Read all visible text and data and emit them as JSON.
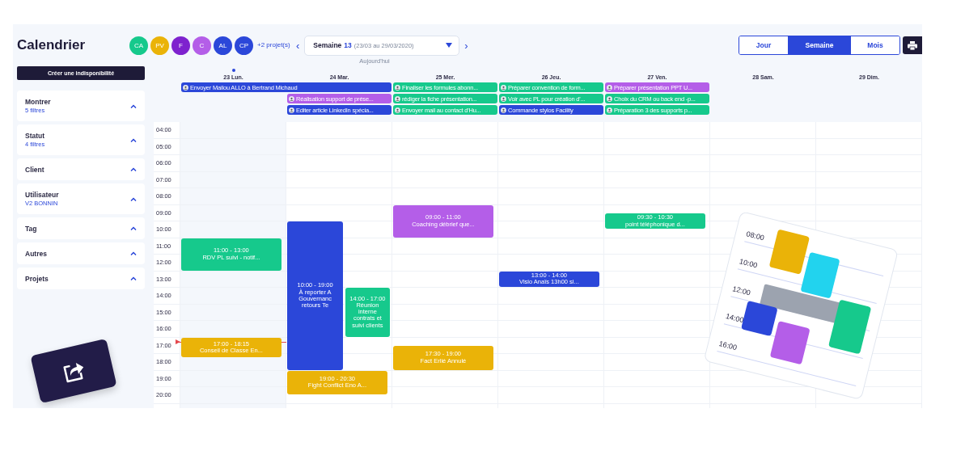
{
  "title": "Calendrier",
  "avatars": [
    {
      "initials": "CA",
      "color": "#16c98c"
    },
    {
      "initials": "PV",
      "color": "#eab308"
    },
    {
      "initials": "F",
      "color": "#7e22ce"
    },
    {
      "initials": "C",
      "color": "#b45ee8"
    },
    {
      "initials": "AL",
      "color": "#2b47d9"
    },
    {
      "initials": "CP",
      "color": "#2b47d9"
    }
  ],
  "more_projects": "+2 projet(s)",
  "prev": "‹",
  "next": "›",
  "week_selector": {
    "label": "Semaine",
    "number": "13",
    "range": "(23/03 au 29/03/2020)"
  },
  "today_link": "Aujourd'hui",
  "views": [
    {
      "label": "Jour",
      "selected": false
    },
    {
      "label": "Semaine",
      "selected": true
    },
    {
      "label": "Mois",
      "selected": false
    }
  ],
  "create_button": "Créer une indisponibilité",
  "filters": [
    {
      "title": "Montrer",
      "subtitle": "5 filtres"
    },
    {
      "title": "Statut",
      "subtitle": "4 filtres"
    },
    {
      "title": "Client"
    },
    {
      "title": "Utilisateur",
      "subtitle": "V2 BONNIN"
    },
    {
      "title": "Tag"
    },
    {
      "title": "Autres"
    },
    {
      "title": "Projets"
    }
  ],
  "hours": [
    "04:00",
    "05:00",
    "06:00",
    "07:00",
    "08:00",
    "09:00",
    "10:00",
    "11:00",
    "12:00",
    "13:00",
    "14:00",
    "15:00",
    "16:00",
    "17:00",
    "18:00",
    "19:00",
    "20:00"
  ],
  "days": [
    {
      "label": "23 Lun.",
      "today": true,
      "all_day": [
        {
          "title": "Envoyer Mailou ALLO à Bertrand Michaud",
          "color": "#2b47d9",
          "kind": "two-day"
        }
      ],
      "events": [
        {
          "time": "11:00 - 13:00",
          "title": "RDV PL suivi - notif...",
          "color": "#16c98c",
          "overlap": false
        },
        {
          "time": "17:00 - 18:15",
          "title": "Conseil de Classe En...",
          "color": "#eab308",
          "overlap": false
        }
      ]
    },
    {
      "label": "24 Mar.",
      "today": false,
      "all_day": [
        {
          "title": "Réalisation support de prése...",
          "color": "#b45ee8",
          "kind": "one-day"
        },
        {
          "title": "Editer article LinkedIn spécia...",
          "color": "#2b47d9",
          "kind": "one-day"
        }
      ],
      "events": [
        {
          "time": "10:00 - 19:00",
          "title": "À reporter A Gouvernanc retours Te",
          "color": "#2b47d9",
          "overlap": false
        },
        {
          "time": "14:00 - 17:00",
          "title": "Réunion interne contrats et suivi clients",
          "color": "#16c98c",
          "overlap": true
        },
        {
          "time": "19:00 - 20:30",
          "title": "Fight Conflict Eno A...",
          "color": "#eab308",
          "overlap": false
        }
      ]
    },
    {
      "label": "25 Mer.",
      "today": false,
      "all_day": [
        {
          "title": "Finaliser les formules abonn...",
          "color": "#16c98c",
          "kind": "one-day"
        },
        {
          "title": "rédiger la fiche présentation...",
          "color": "#16c98c",
          "kind": "one-day"
        },
        {
          "title": "Envoyer mail au contact d'Hu...",
          "color": "#16c98c",
          "kind": "one-day"
        }
      ],
      "events": [
        {
          "time": "09:00 - 11:00",
          "title": "Coaching débrief que...",
          "color": "#b45ee8",
          "overlap": false
        },
        {
          "time": "17:30 - 19:00",
          "title": "Fact Erlié Annulé",
          "color": "#eab308",
          "overlap": false
        }
      ]
    },
    {
      "label": "26 Jeu.",
      "today": false,
      "all_day": [
        {
          "title": "Préparer convention de form...",
          "color": "#16c98c",
          "kind": "one-day"
        },
        {
          "title": "Voir avec PL pour création d'...",
          "color": "#16c98c",
          "kind": "one-day"
        },
        {
          "title": "Commande stylos Facility",
          "color": "#2b47d9",
          "kind": "one-day"
        }
      ],
      "events": [
        {
          "time": "13:00 - 14:00",
          "title": "Visio Anaïs 13h00 si...",
          "color": "#2b47d9",
          "overlap": false
        }
      ]
    },
    {
      "label": "27 Ven.",
      "today": false,
      "all_day": [
        {
          "title": "Préparer présentation PPT U...",
          "color": "#b45ee8",
          "kind": "one-day"
        },
        {
          "title": "Choix du CRM ou back end -p...",
          "color": "#16c98c",
          "kind": "one-day"
        },
        {
          "title": "Préparation 3 des supports p...",
          "color": "#16c98c",
          "kind": "one-day"
        }
      ],
      "events": [
        {
          "time": "09:30 - 10:30",
          "title": "point téléphonique d...",
          "color": "#16c98c",
          "overlap": false
        }
      ]
    },
    {
      "label": "28 Sam.",
      "today": false
    },
    {
      "label": "29 Dim.",
      "today": false
    }
  ],
  "illustration": {
    "times": [
      "08:00",
      "10:00",
      "12:00",
      "14:00",
      "16:00"
    ]
  }
}
